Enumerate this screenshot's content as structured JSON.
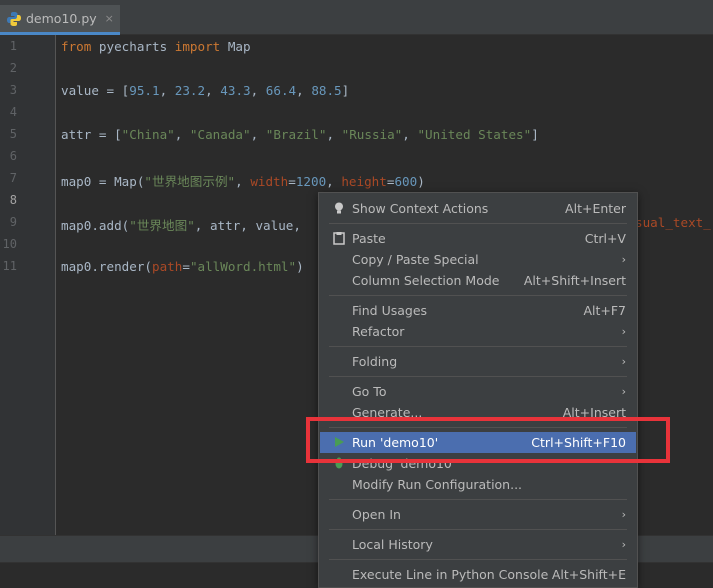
{
  "tab": {
    "filename": "demo10.py",
    "close": "×"
  },
  "gutter": {
    "lines": [
      "1",
      "2",
      "3",
      "4",
      "5",
      "6",
      "7",
      "8",
      "9",
      "10",
      "11"
    ]
  },
  "code": {
    "l1": {
      "kw1": "from",
      "mod": " pyecharts ",
      "kw2": "import",
      "name": " Map"
    },
    "l3": {
      "a": "value = [",
      "n1": "95.1",
      "c1": ", ",
      "n2": "23.2",
      "c2": ", ",
      "n3": "43.3",
      "c3": ", ",
      "n4": "66.4",
      "c4": ", ",
      "n5": "88.5",
      "b": "]"
    },
    "l5": {
      "a": "attr = [",
      "s1": "\"China\"",
      "c1": ", ",
      "s2": "\"Canada\"",
      "c2": ", ",
      "s3": "\"Brazil\"",
      "c3": ", ",
      "s4": "\"Russia\"",
      "c4": ", ",
      "s5": "\"United States\"",
      "b": "]"
    },
    "l7": {
      "a": "map0 = Map(",
      "s1": "\"世界地图示例\"",
      "c1": ", ",
      "p1": "width",
      "e1": "=",
      "n1": "1200",
      "c2": ", ",
      "p2": "height",
      "e2": "=",
      "n2": "600",
      "b": ")"
    },
    "l9": {
      "a": "map0.add(",
      "s1": "\"世界地图\"",
      "b": ", attr, value,",
      "tail": "sual_text_"
    },
    "l11": {
      "a": "map0.render(",
      "p1": "path",
      "e1": "=",
      "s1": "\"allWord.html\"",
      "b": ")"
    }
  },
  "menu": {
    "show_context_actions": {
      "label": "Show Context Actions",
      "shortcut": "Alt+Enter"
    },
    "paste": {
      "label": "Paste",
      "shortcut": "Ctrl+V"
    },
    "copy_paste_special": {
      "label": "Copy / Paste Special"
    },
    "column_selection_mode": {
      "label": "Column Selection Mode",
      "shortcut": "Alt+Shift+Insert"
    },
    "find_usages": {
      "label": "Find Usages",
      "shortcut": "Alt+F7"
    },
    "refactor": {
      "label": "Refactor"
    },
    "folding": {
      "label": "Folding"
    },
    "go_to": {
      "label": "Go To"
    },
    "generate": {
      "label": "Generate...",
      "shortcut": "Alt+Insert"
    },
    "run": {
      "label": "Run 'demo10'",
      "shortcut": "Ctrl+Shift+F10"
    },
    "debug": {
      "label": "Debug 'demo10'"
    },
    "modify_run": {
      "label": "Modify Run Configuration..."
    },
    "open_in": {
      "label": "Open In"
    },
    "local_history": {
      "label": "Local History"
    },
    "execute_line": {
      "label": "Execute Line in Python Console",
      "shortcut": "Alt+Shift+E"
    },
    "submenu_arrow": "›"
  },
  "colors": {
    "selection": "#4b6eaf",
    "highlight_box": "#e8333a",
    "run_icon": "#499c54"
  }
}
